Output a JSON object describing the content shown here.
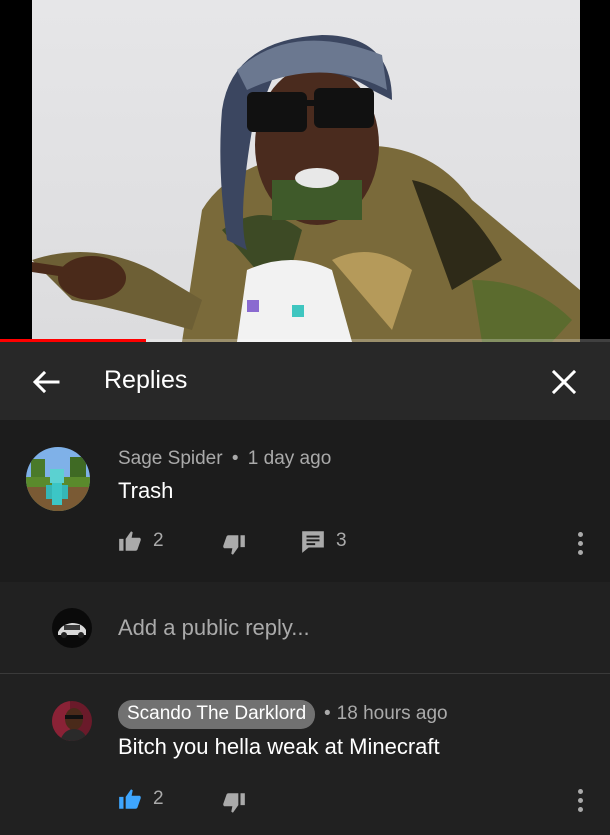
{
  "video": {
    "progress_fraction": 0.24
  },
  "header": {
    "title": "Replies"
  },
  "top_comment": {
    "author": "Sage Spider",
    "separator": "•",
    "time": "1 day ago",
    "text": "Trash",
    "likes": "2",
    "replies": "3"
  },
  "reply_input": {
    "placeholder": "Add a public reply..."
  },
  "reply": {
    "author": "Scando The Darklord",
    "separator": "•",
    "time": "18 hours ago",
    "text": "Bitch you hella weak at Minecraft",
    "likes": "2"
  },
  "colors": {
    "background": "#212121",
    "header": "#282828",
    "progress": "#ff0000",
    "liked_accent": "#3ea6ff",
    "muted_text": "#aaaaaa"
  }
}
